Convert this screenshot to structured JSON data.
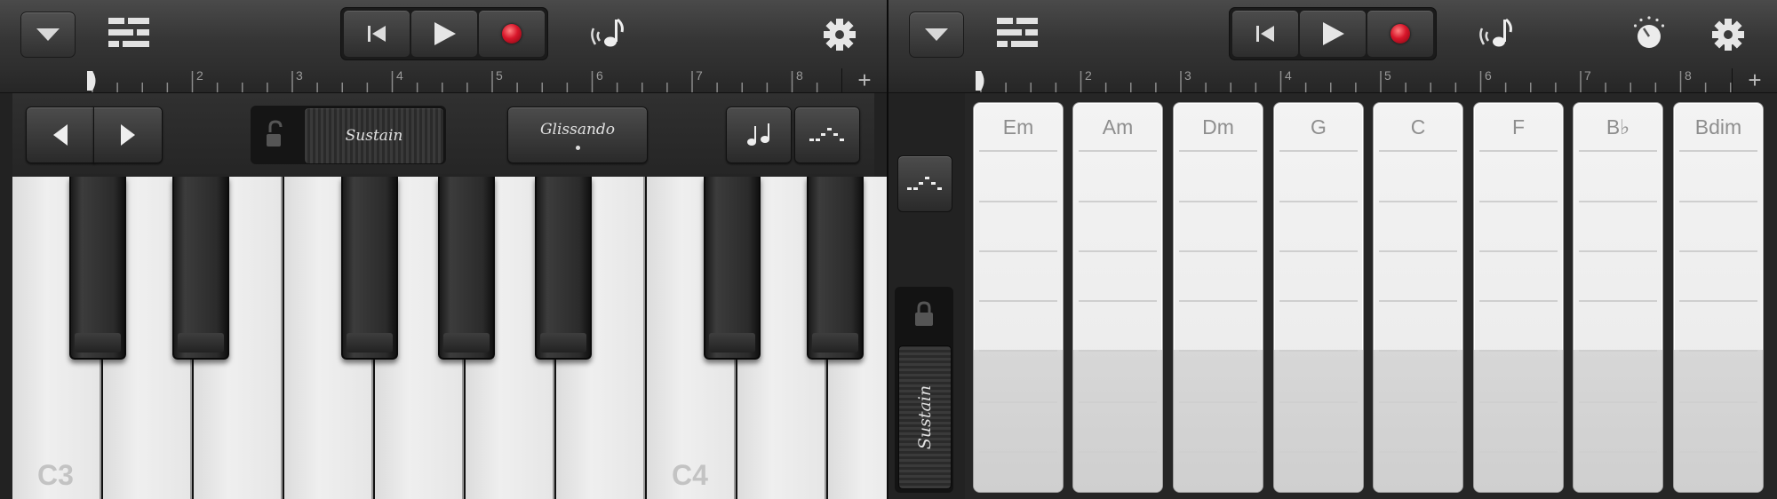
{
  "left_panel": {
    "toolbar": {
      "icons": [
        "chevron-down-icon",
        "tracks-view-icon",
        "skip-back-icon",
        "play-icon",
        "record-icon",
        "metronome-icon",
        "gear-icon"
      ]
    },
    "ruler": {
      "bars": [
        "1",
        "2",
        "3",
        "4",
        "5",
        "6",
        "7",
        "8"
      ],
      "add_label": "+"
    },
    "controls": {
      "sustain_label": "Sustain",
      "glissando_label": "Glissando",
      "icons": [
        "arrow-left-icon",
        "arrow-right-icon",
        "lock-open-icon",
        "note-icon",
        "arpeggio-icon"
      ]
    },
    "keyboard": {
      "octave_labels": [
        "C3",
        "C4"
      ]
    }
  },
  "right_panel": {
    "toolbar": {
      "icons": [
        "chevron-down-icon",
        "tracks-view-icon",
        "skip-back-icon",
        "play-icon",
        "record-icon",
        "metronome-icon",
        "knob-icon",
        "gear-icon"
      ]
    },
    "ruler": {
      "bars": [
        "1",
        "2",
        "3",
        "4",
        "5",
        "6",
        "7",
        "8"
      ],
      "add_label": "+"
    },
    "side": {
      "sustain_label": "Sustain",
      "icons": [
        "arpeggio-icon",
        "lock-icon"
      ]
    },
    "chords": [
      "Em",
      "Am",
      "Dm",
      "G",
      "C",
      "F",
      "B♭",
      "Bdim"
    ]
  },
  "colors": {
    "record": "#d8162a",
    "background": "#222222",
    "key_white": "#ececec",
    "chord_strip": "#eeeeee"
  }
}
